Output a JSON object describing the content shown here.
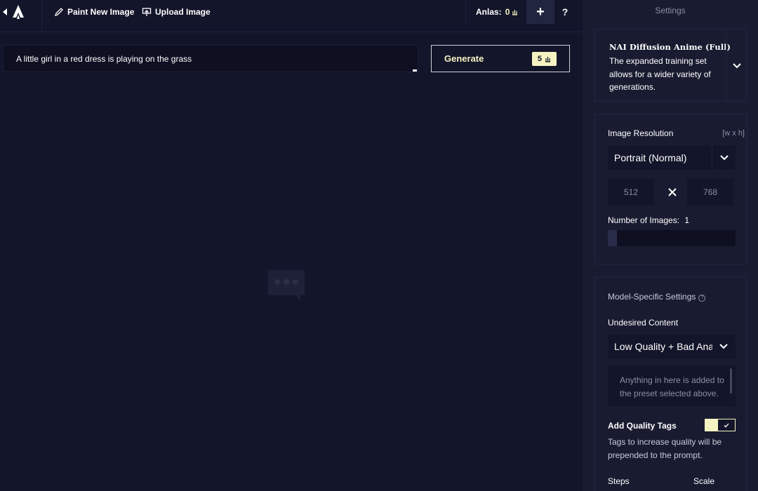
{
  "toolbar": {
    "paint_label": "Paint New Image",
    "upload_label": "Upload Image",
    "anlas_label": "Anlas:",
    "anlas_value": "0",
    "plus_label": "+",
    "help_label": "?"
  },
  "prompt": {
    "value": "A little girl in a red dress is playing on the grass"
  },
  "generate": {
    "label": "Generate",
    "cost": "5"
  },
  "sidebar": {
    "title": "Settings",
    "model": {
      "name": "NAI Diffusion Anime (Full)",
      "description": "The expanded training set allows for a wider variety of generations."
    },
    "resolution": {
      "label": "Image Resolution",
      "hint": "[w x h]",
      "preset": "Portrait (Normal)",
      "width": "512",
      "height": "768",
      "num_images_label": "Number of Images:",
      "num_images_value": "1"
    },
    "model_settings": {
      "title": "Model-Specific Settings",
      "undesired_label": "Undesired Content",
      "undesired_preset": "Low Quality + Bad Anatomy",
      "undesired_placeholder": "Anything in here is added to the preset selected above.",
      "quality_tags_label": "Add Quality Tags",
      "quality_tags_enabled": true,
      "quality_tags_desc": "Tags to increase quality will be prepended to the prompt.",
      "steps_label": "Steps",
      "scale_label": "Scale"
    }
  },
  "colors": {
    "background": "#13152a",
    "sidebar": "#191b31",
    "accent": "#f5f3c2"
  }
}
